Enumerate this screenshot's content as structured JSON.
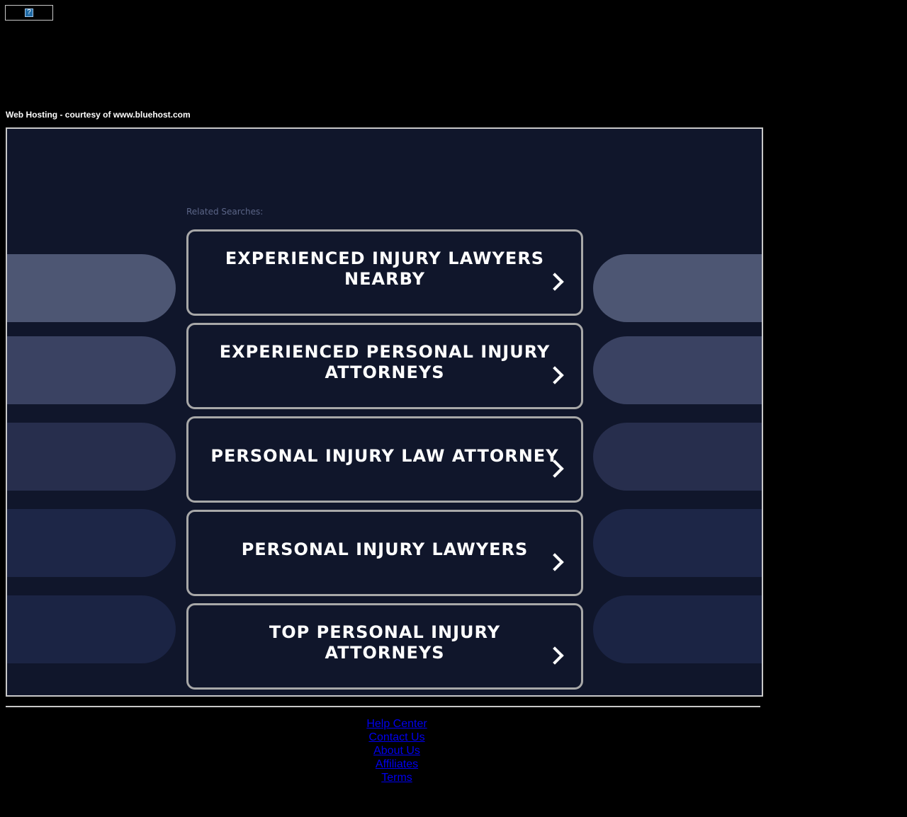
{
  "header": {
    "hosting_text": "Web Hosting - courtesy of www.bluehost.com",
    "broken_image_glyph": "?"
  },
  "main": {
    "related_label": "Related Searches:",
    "searches": [
      {
        "label": "EXPERIENCED INJURY LAWYERS NEARBY"
      },
      {
        "label": "EXPERIENCED PERSONAL INJURY ATTORNEYS"
      },
      {
        "label": "PERSONAL INJURY LAW ATTORNEY"
      },
      {
        "label": "PERSONAL INJURY LAWYERS"
      },
      {
        "label": "TOP PERSONAL INJURY ATTORNEYS"
      }
    ],
    "icon": "chevron-right-icon"
  },
  "footer": {
    "links": [
      "Help Center",
      "Contact Us",
      "About Us",
      "Affiliates",
      "Terms"
    ]
  },
  "colors": {
    "background": "#000000",
    "panel": "#10162b",
    "button_border": "#a8a8a8",
    "link": "#0000ee",
    "pill_shades": [
      "#4d5673",
      "#3a4262",
      "#272e4d",
      "#1d2647",
      "#1b2444"
    ]
  }
}
